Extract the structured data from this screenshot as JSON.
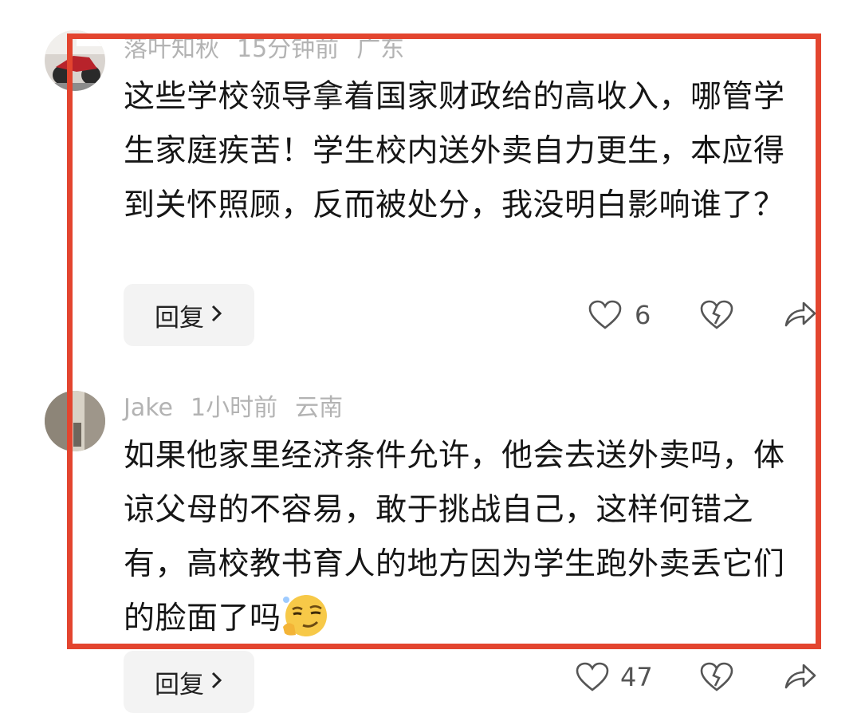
{
  "comments": [
    {
      "username": "落叶知秋",
      "time": "15分钟前",
      "location": "广东",
      "text": "这些学校领导拿着国家财政给的高收入，哪管学生家庭疾苦！学生校内送外卖自力更生，本应得到关怀照顾，反而被处分，我没明白影响谁了？",
      "reply_label": "回复",
      "like_count": "6"
    },
    {
      "username": "Jake",
      "time": "1小时前",
      "location": "云南",
      "text": "如果他家里经济条件允许，他会去送外卖吗，体谅父母的不容易，敢于挑战自己，这样何错之有，高校教书育人的地方因为学生跑外卖丢它们的脸面了吗",
      "emoji": "smirk-emoji",
      "reply_label": "回复",
      "like_count": "47"
    }
  ],
  "highlight_color": "#e3452f",
  "icons": {
    "like": "heart-outline-icon",
    "dislike": "broken-heart-icon",
    "share": "share-arrow-icon",
    "reply_chevron": "chevron-right-icon"
  }
}
